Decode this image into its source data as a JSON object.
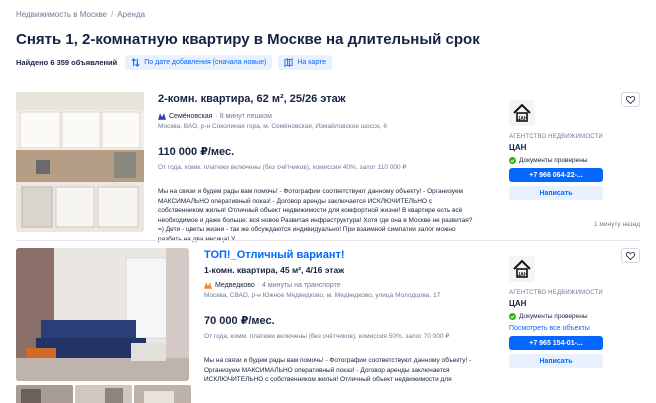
{
  "breadcrumb": {
    "item1": "Недвижимость в Москве",
    "separator": "/",
    "item2": "Аренда"
  },
  "page_title": "Снять 1, 2-комнатную квартиру в Москве на длительный срок",
  "toolbar": {
    "found": "Найдено 6 359 объявлений",
    "sort_label": "По дате добавления (сначала новые)",
    "map_label": "На карте"
  },
  "colors": {
    "accent": "#0468ff",
    "accent_light": "#e9f1fe",
    "text": "#152242",
    "muted": "#707a95",
    "metro_line_1": "#2d3fb8",
    "metro_line_2": "#f18a2c"
  },
  "listings": [
    {
      "title": "2-комн. квартира, 62 м², 25/26 этаж",
      "metro_station": "Семёновская",
      "metro_walk": "· 8 минут пешком",
      "address": "Москва, ВАО, р-н Соколиная гора, м. Семёновская, Измайловское шоссе, 6",
      "price": "110 000 ₽/мес.",
      "price_note": "От года, комм. платежи включены (без счётчиков), комиссия 40%, залог 110 000 ₽",
      "description": "Мы на связи и будем рады вам помочь! - Фотографии соответствуют данному объекту! - Организуем МАКСИМАЛЬНО оперативный показ! - Договор аренды заключается ИСКЛЮЧИТЕЛЬНО с собственником жилья! Отличный объект недвижимости для комфортной жизни! В квартире есть всё необходимое и даже больше: вся новое Развитая инфраструктура! Хотя где она в Москве не развитая?=) Дети - цветы жизни - так же обсуждаются индивидуально! При взаимной симпатии залог можно разбить на два месяца! У...",
      "agent_type": "АГЕНТСТВО НЕДВИЖИМОСТИ",
      "agent_name": "ЦАН",
      "verified": "Документы проверены",
      "phone": "+7 966 064-22-...",
      "write": "Написать",
      "time_ago": "1 минуту назад"
    },
    {
      "title": "ТОП!_Отличный вариант!",
      "subtitle": "1-комн. квартира, 45 м², 4/16 этаж",
      "metro_station": "Медведково",
      "metro_walk": "· 4 минуты на транспорте",
      "address": "Москва, СВАО, р-н Южное Медведково, м. Медведково, улица Молодцова, 17",
      "price": "70 000 ₽/мес.",
      "price_note": "От года, комм. платежи включены (без счётчиков), комиссия 50%, залог 70 000 ₽",
      "description": "Мы на связи и будем рады вам помочь! - Фотографии соответствуют данному объекту! - Организуем МАКСИМАЛЬНО оперативный показ! - Договор аренды заключается ИСКЛЮЧИТЕЛЬНО с собственником жилья! Отличный объект недвижимости для",
      "agent_type": "АГЕНТСТВО НЕДВИЖИМОСТИ",
      "agent_name": "ЦАН",
      "verified": "Документы проверены",
      "all_objects": "Посмотреть все объекты",
      "phone": "+7 965 154-01-...",
      "write": "Написать"
    }
  ]
}
